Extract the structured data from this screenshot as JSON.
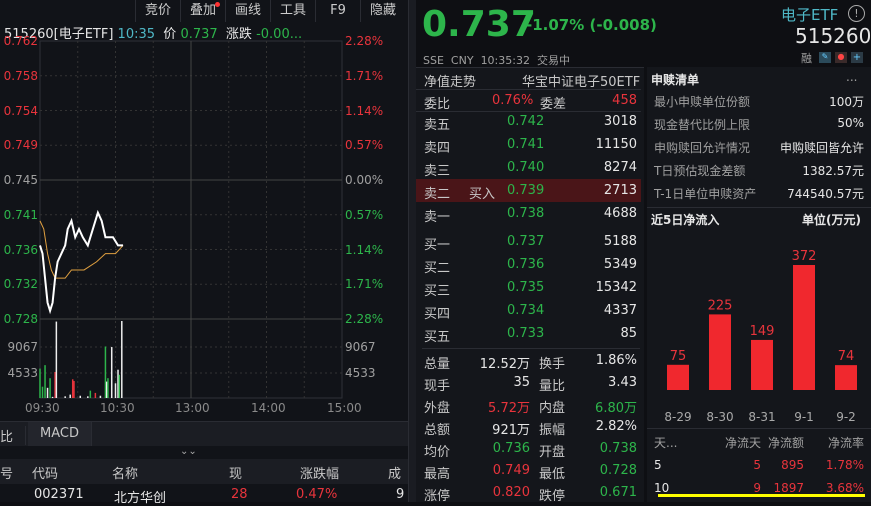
{
  "toolbar": {
    "items": [
      "竞价",
      "叠加",
      "画线",
      "工具",
      "F9",
      "隐藏"
    ]
  },
  "chart_header": {
    "code": "515260[电子ETF]",
    "time": "10:35",
    "price_label": "价",
    "price": "0.737",
    "change_label": "涨跌",
    "change": "-0.00..."
  },
  "chart_data": {
    "type": "line",
    "title": "515260 intraday",
    "y_left_ticks": [
      "0.762",
      "0.758",
      "0.754",
      "0.749",
      "0.745",
      "0.741",
      "0.736",
      "0.732",
      "0.728"
    ],
    "y_right_ticks": [
      "2.28%",
      "1.71%",
      "1.14%",
      "0.57%",
      "0.00%",
      "0.57%",
      "1.14%",
      "1.71%",
      "2.28%"
    ],
    "volume_ticks": [
      "9067",
      "4533"
    ],
    "x_ticks": [
      "09:30",
      "10:30",
      "13:00",
      "14:00",
      "15:00"
    ],
    "ylim": [
      0.728,
      0.762
    ],
    "vol_max": 13600,
    "minutes_total": 240,
    "price": [
      [
        0,
        0.737
      ],
      [
        2,
        0.736
      ],
      [
        4,
        0.733
      ],
      [
        6,
        0.73
      ],
      [
        8,
        0.729
      ],
      [
        10,
        0.73
      ],
      [
        12,
        0.733
      ],
      [
        14,
        0.735
      ],
      [
        17,
        0.736
      ],
      [
        20,
        0.737
      ],
      [
        22,
        0.739
      ],
      [
        25,
        0.74
      ],
      [
        28,
        0.738
      ],
      [
        31,
        0.739
      ],
      [
        34,
        0.738
      ],
      [
        38,
        0.737
      ],
      [
        42,
        0.739
      ],
      [
        46,
        0.741
      ],
      [
        49,
        0.74
      ],
      [
        52,
        0.738
      ],
      [
        58,
        0.738
      ],
      [
        62,
        0.737
      ],
      [
        66,
        0.737
      ]
    ],
    "avg": [
      [
        0,
        0.74
      ],
      [
        3,
        0.739
      ],
      [
        6,
        0.736
      ],
      [
        9,
        0.734
      ],
      [
        12,
        0.733
      ],
      [
        20,
        0.733
      ],
      [
        25,
        0.734
      ],
      [
        35,
        0.734
      ],
      [
        45,
        0.735
      ],
      [
        52,
        0.736
      ],
      [
        60,
        0.736
      ],
      [
        66,
        0.737
      ]
    ],
    "volume": [
      [
        0,
        5200,
        "g"
      ],
      [
        2,
        2000,
        "g"
      ],
      [
        4,
        5800,
        "g"
      ],
      [
        6,
        1800,
        "w"
      ],
      [
        8,
        3500,
        "g"
      ],
      [
        10,
        200,
        "w"
      ],
      [
        12,
        4600,
        "r"
      ],
      [
        13,
        13500,
        "w"
      ],
      [
        20,
        300,
        "w"
      ],
      [
        24,
        600,
        "w"
      ],
      [
        26,
        3300,
        "r"
      ],
      [
        27,
        3000,
        "r"
      ],
      [
        32,
        400,
        "w"
      ],
      [
        38,
        300,
        "w"
      ],
      [
        40,
        1300,
        "g"
      ],
      [
        44,
        900,
        "r"
      ],
      [
        48,
        400,
        "w"
      ],
      [
        52,
        9100,
        "g"
      ],
      [
        53,
        2900,
        "w"
      ],
      [
        54,
        3500,
        "g"
      ],
      [
        57,
        9000,
        "w"
      ],
      [
        60,
        2600,
        "w"
      ],
      [
        62,
        5000,
        "w"
      ],
      [
        63,
        4100,
        "g"
      ],
      [
        65,
        13600,
        "w"
      ]
    ]
  },
  "bottom_tabs": [
    "比",
    "MACD"
  ],
  "table": {
    "headers": [
      "号",
      "代码",
      "名称",
      "现",
      "涨跌幅",
      "成"
    ],
    "rows": [
      [
        "",
        "002371",
        "北方华创",
        "28",
        "0.47%",
        "9"
      ]
    ]
  },
  "quote": {
    "price": "0.737",
    "change": "-1.07% (-0.008)",
    "exchange": "SSE",
    "currency": "CNY",
    "time": "10:35:32",
    "status": "交易中",
    "name": "电子ETF",
    "code": "515260",
    "margin_label": "融"
  },
  "orderbook": {
    "tab": "净值走势",
    "fund_name": "华宝中证电子50ETF",
    "ratio_label": "委比",
    "ratio": "0.76%",
    "diff_label": "委差",
    "diff": "458",
    "asks": [
      {
        "label": "卖五",
        "price": "0.742",
        "vol": "3018"
      },
      {
        "label": "卖四",
        "price": "0.741",
        "vol": "11150"
      },
      {
        "label": "卖三",
        "price": "0.740",
        "vol": "8274"
      },
      {
        "label": "卖二",
        "tag": "买入",
        "price": "0.739",
        "vol": "2713"
      },
      {
        "label": "卖一",
        "price": "0.738",
        "vol": "4688"
      }
    ],
    "bids": [
      {
        "label": "买一",
        "price": "0.737",
        "vol": "5188"
      },
      {
        "label": "买二",
        "price": "0.736",
        "vol": "5349"
      },
      {
        "label": "买三",
        "price": "0.735",
        "vol": "15342"
      },
      {
        "label": "买四",
        "price": "0.734",
        "vol": "4337"
      },
      {
        "label": "买五",
        "price": "0.733",
        "vol": "85"
      }
    ],
    "stats": [
      [
        "总量",
        "12.52万",
        "换手",
        "1.86%"
      ],
      [
        "现手",
        "35",
        "量比",
        "3.43"
      ],
      [
        "外盘",
        "5.72万",
        "内盘",
        "6.80万"
      ],
      [
        "总额",
        "921万",
        "振幅",
        "2.82%"
      ],
      [
        "均价",
        "0.736",
        "开盘",
        "0.738"
      ],
      [
        "最高",
        "0.749",
        "最低",
        "0.728"
      ],
      [
        "涨停",
        "0.820",
        "跌停",
        "0.671"
      ]
    ]
  },
  "redemption": {
    "title": "申赎清单",
    "more": "...",
    "rows": [
      [
        "最小申赎单位份额",
        "100万"
      ],
      [
        "现金替代比例上限",
        "50%"
      ],
      [
        "申购赎回允许情况",
        "申购赎回皆允许"
      ],
      [
        "T日预估现金差额",
        "1382.57元"
      ],
      [
        "T-1日单位申赎资产",
        "744540.57元"
      ]
    ]
  },
  "netflow": {
    "title": "近5日净流入",
    "unit": "单位(万元)",
    "chart_data": {
      "type": "bar",
      "categories": [
        "8-29",
        "8-30",
        "8-31",
        "9-1",
        "9-2"
      ],
      "values": [
        75,
        225,
        149,
        372,
        74
      ],
      "ylim": [
        0,
        372
      ]
    },
    "headers": [
      "天...",
      "净流天",
      "净流额",
      "净流率"
    ],
    "rows": [
      [
        "5",
        "5",
        "895",
        "1.78%"
      ],
      [
        "10",
        "9",
        "1897",
        "3.68%"
      ]
    ]
  },
  "colors": {
    "up": "#e8343c",
    "down": "#2db54b",
    "bar": "#f0282e",
    "highlight": "#ffff00"
  }
}
